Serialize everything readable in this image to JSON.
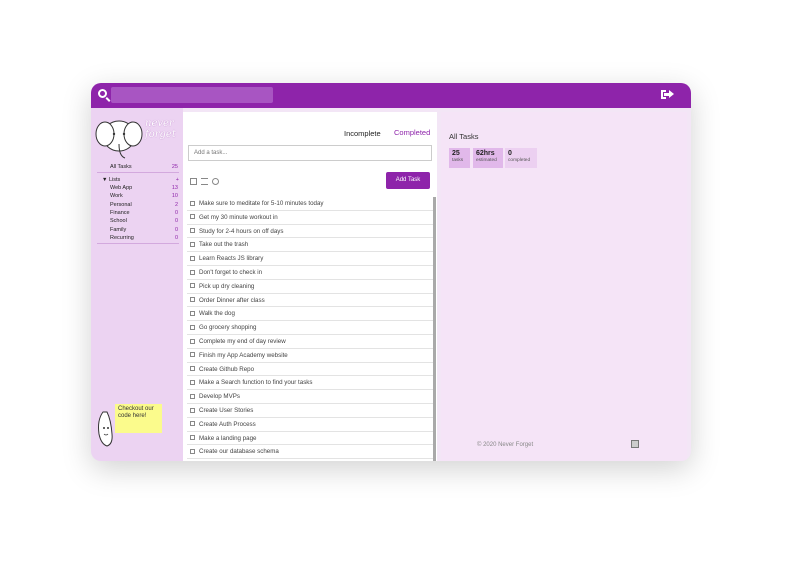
{
  "header": {
    "search_placeholder": ""
  },
  "sidebar": {
    "logo_text_1": "never",
    "logo_text_2": "forget",
    "all_tasks": {
      "label": "All Tasks",
      "count": "25"
    },
    "lists_label": "▼ Lists",
    "lists_add": "+",
    "lists": [
      {
        "label": "Web App",
        "count": "13"
      },
      {
        "label": "Work",
        "count": "10"
      },
      {
        "label": "Personal",
        "count": "2"
      },
      {
        "label": "Finance",
        "count": "0"
      },
      {
        "label": "School",
        "count": "0"
      },
      {
        "label": "Family",
        "count": "0"
      },
      {
        "label": "Recurring",
        "count": "0"
      }
    ],
    "note": "Checkout our code here!"
  },
  "main": {
    "tab_incomplete": "Incomplete",
    "tab_completed": "Completed",
    "add_placeholder": "Add a task...",
    "add_button": "Add Task",
    "tasks": [
      "Make sure to meditate for 5-10 minutes today",
      "Get my 30 minute workout in",
      "Study for 2-4 hours on off days",
      "Take out the trash",
      "Learn Reacts JS library",
      "Don't forget to check in",
      "Pick up dry cleaning",
      "Order Dinner after class",
      "Walk the dog",
      "Go grocery shopping",
      "Complete my end of day review",
      "Finish my App Academy website",
      "Create Github Repo",
      "Make a Search function to find your tasks",
      "Develop MVPs",
      "Create User Stories",
      "Create Auth Process",
      "Make a landing page",
      "Create our database schema"
    ]
  },
  "details": {
    "title": "All Tasks",
    "stats": [
      {
        "num": "25",
        "label": "tasks"
      },
      {
        "num": "62hrs",
        "label": "estimated"
      },
      {
        "num": "0",
        "label": "completed"
      }
    ],
    "footer": "© 2020 Never Forget"
  },
  "colors": {
    "accent": "#8e24aa",
    "sidebar": "#ecd3f2",
    "panel": "#f5e4f7"
  }
}
